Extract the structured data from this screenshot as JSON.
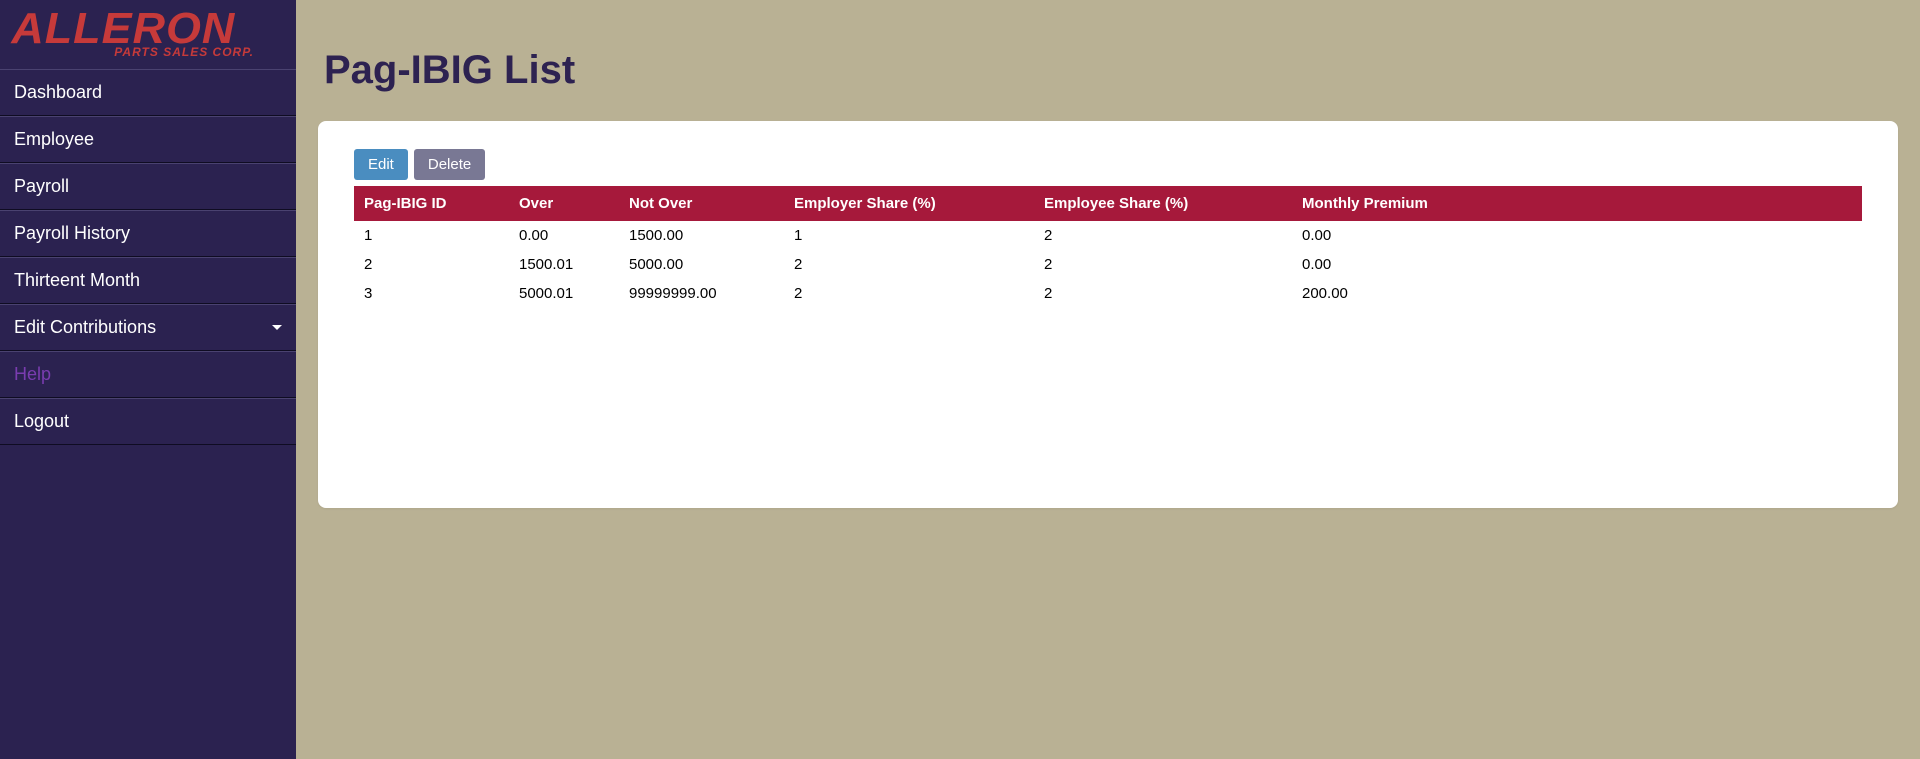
{
  "brand": {
    "name": "ALLERON",
    "tagline": "PARTS SALES CORP."
  },
  "sidebar": {
    "items": [
      {
        "label": "Dashboard"
      },
      {
        "label": "Employee"
      },
      {
        "label": "Payroll"
      },
      {
        "label": "Payroll History"
      },
      {
        "label": "Thirteent Month"
      },
      {
        "label": "Edit Contributions",
        "hasCaret": true
      },
      {
        "label": "Help",
        "help": true
      },
      {
        "label": "Logout"
      }
    ]
  },
  "page": {
    "title": "Pag-IBIG List"
  },
  "buttons": {
    "edit": "Edit",
    "delete": "Delete"
  },
  "table": {
    "headers": {
      "id": "Pag-IBIG ID",
      "over": "Over",
      "notOver": "Not Over",
      "employerShare": "Employer Share (%)",
      "employeeShare": "Employee Share (%)",
      "monthlyPremium": "Monthly Premium"
    },
    "rows": [
      {
        "id": "1",
        "over": "0.00",
        "notOver": "1500.00",
        "employerShare": "1",
        "employeeShare": "2",
        "monthlyPremium": "0.00"
      },
      {
        "id": "2",
        "over": "1500.01",
        "notOver": "5000.00",
        "employerShare": "2",
        "employeeShare": "2",
        "monthlyPremium": "0.00"
      },
      {
        "id": "3",
        "over": "5000.01",
        "notOver": "99999999.00",
        "employerShare": "2",
        "employeeShare": "2",
        "monthlyPremium": "200.00"
      }
    ]
  }
}
